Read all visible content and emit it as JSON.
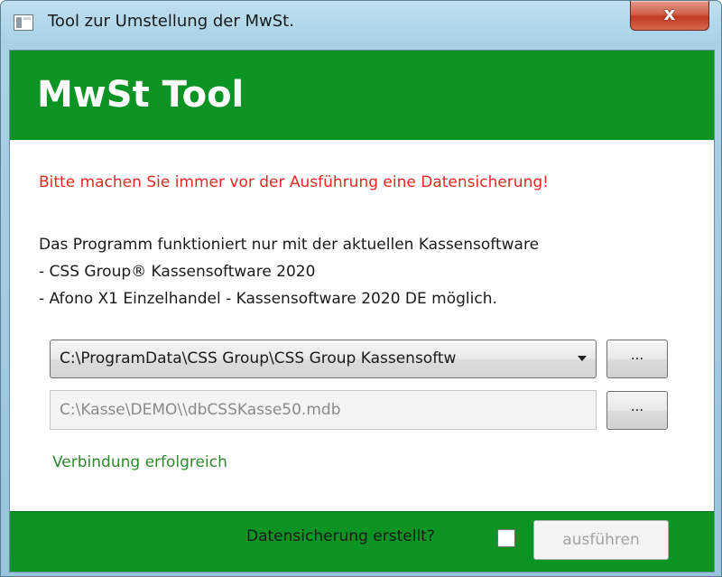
{
  "window": {
    "title": "Tool zur Umstellung der MwSt.",
    "close_label": "x"
  },
  "header": {
    "app_title": "MwSt Tool"
  },
  "content": {
    "warning": "Bitte machen Sie immer vor der Ausführung eine Datensicherung!",
    "info_lines": [
      "Das Programm funktioniert nur mit der aktuellen Kassensoftware",
      "- CSS Group® Kassensoftware 2020",
      "- Afono X1 Einzelhandel - Kassensoftware 2020 DE möglich."
    ],
    "program_path_select": {
      "value": "C:\\ProgramData\\CSS Group\\CSS Group Kassensoftw"
    },
    "database_path_field": {
      "value": "C:\\Kasse\\DEMO\\\\dbCSSKasse50.mdb"
    },
    "browse_label": "...",
    "status": "Verbindung erfolgreich"
  },
  "footer": {
    "backup_label": "Datensicherung erstellt?",
    "backup_checked": false,
    "run_label": "ausführen"
  },
  "colors": {
    "accent_green": "#0b9323",
    "warning_red": "#e02a22",
    "status_green": "#2c8a2c"
  }
}
